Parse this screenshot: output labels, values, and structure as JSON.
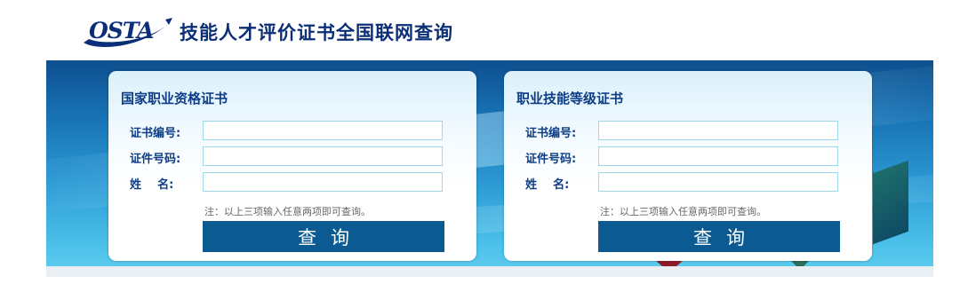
{
  "header": {
    "logo_text": "OSTA",
    "title": "技能人才评价证书全国联网查询"
  },
  "cards": {
    "national": {
      "title": "国家职业资格证书",
      "cert_no_label": "证书编号:",
      "id_no_label": "证件号码:",
      "name_label": "姓    名:",
      "cert_no_value": "",
      "id_no_value": "",
      "name_value": "",
      "note": "注：以上三项输入任意两项即可查询。",
      "query_label": "查询"
    },
    "skill": {
      "title": "职业技能等级证书",
      "cert_no_label": "证书编号:",
      "id_no_label": "证件号码:",
      "name_label": "姓    名:",
      "cert_no_value": "",
      "id_no_value": "",
      "name_value": "",
      "note": "注：以上三项输入任意两项即可查询。",
      "query_label": "查询"
    }
  },
  "colors": {
    "brand_navy": "#0b2e78",
    "label_blue": "#0d3d86",
    "button_blue": "#0b5a92",
    "input_border": "#9ed6ea"
  },
  "icons": {
    "logo": "osta-logo-swoosh"
  }
}
